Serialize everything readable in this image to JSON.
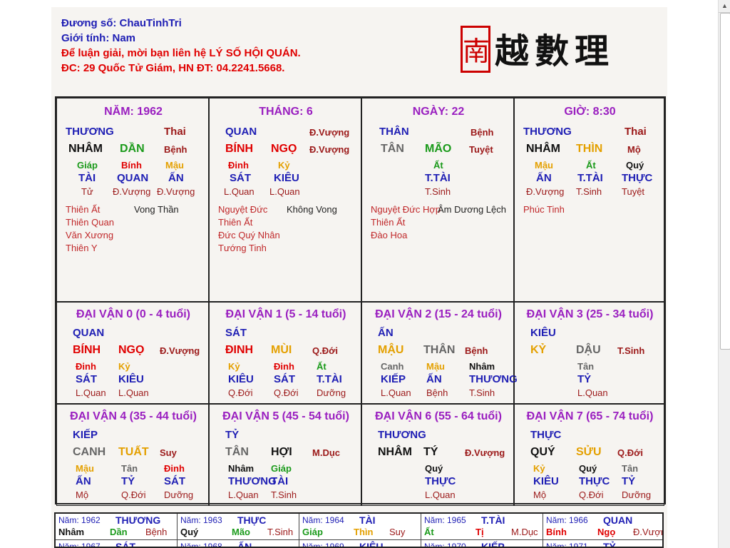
{
  "header": {
    "duong_so": "Đương số: ChauTinhTri",
    "gioi_tinh": "Giới tính:  Nam",
    "contact1": "Để luận giải, mời bạn liên hệ LÝ SỐ HỘI QUÁN.",
    "contact2": "ĐC: 29 Quốc Tử Giám, HN ĐT: 04.2241.5668."
  },
  "logo": {
    "seal": "南",
    "text": "越數理"
  },
  "pillars": [
    {
      "title": "NĂM: 1962",
      "god": "THƯƠNG",
      "phase": "Thai",
      "stem": "NHÂM",
      "branch": "DẦN",
      "branch_phase": "Bệnh",
      "hidden": [
        "Giáp",
        "Bính",
        "Mậu"
      ],
      "hidden_god": [
        "TÀI",
        "QUAN",
        "ẤN"
      ],
      "hidden_phase": [
        "Tử",
        "Đ.Vượng",
        "Đ.Vượng"
      ],
      "stars_l": [
        "Thiên Ất",
        "Thiên Quan",
        "Văn Xương",
        "Thiên Y"
      ],
      "stars_r": [
        "Vong Thần"
      ]
    },
    {
      "title": "THÁNG: 6",
      "god": "QUAN",
      "phase": "Đ.Vượng",
      "stem": "BÍNH",
      "branch": "NGỌ",
      "branch_phase": "Đ.Vượng",
      "hidden": [
        "Đinh",
        "Kỷ"
      ],
      "hidden_god": [
        "SÁT",
        "KIÊU"
      ],
      "hidden_phase": [
        "L.Quan",
        "L.Quan"
      ],
      "stars_l": [
        "Nguyệt Đức",
        "Thiên Ất",
        "Đức Quý Nhân",
        "Tướng Tinh"
      ],
      "stars_r": [
        "Không Vong"
      ]
    },
    {
      "title": "NGÀY: 22",
      "god": "THÂN",
      "phase": "Bệnh",
      "stem": "TÂN",
      "branch": "MÃO",
      "branch_phase": "Tuyệt",
      "hidden": [
        "Ất"
      ],
      "hidden_god": [
        "T.TÀI"
      ],
      "hidden_phase": [
        "T.Sinh"
      ],
      "stars_l": [
        "Nguyệt Đức Hợp",
        "Thiên Ất",
        "Đào Hoa"
      ],
      "stars_r": [
        "Âm Dương Lệch"
      ]
    },
    {
      "title": "GIỜ: 8:30",
      "god": "THƯƠNG",
      "phase": "Thai",
      "stem": "NHÂM",
      "branch": "THÌN",
      "branch_phase": "Mộ",
      "hidden": [
        "Mậu",
        "Ất",
        "Quý"
      ],
      "hidden_god": [
        "ẤN",
        "T.TÀI",
        "THỰC"
      ],
      "hidden_phase": [
        "Đ.Vượng",
        "T.Sinh",
        "Tuyệt"
      ],
      "stars_l": [
        "Phúc Tinh"
      ],
      "stars_r": []
    }
  ],
  "dai_van": [
    {
      "title": "ĐẠI VẬN 0 (0 - 4 tuổi)",
      "god": "QUAN",
      "stem": "BÍNH",
      "branch": "NGỌ",
      "phase": "Đ.Vượng",
      "hidden": [
        "Đinh",
        "Kỷ"
      ],
      "hidden_god": [
        "SÁT",
        "KIÊU"
      ],
      "hidden_phase": [
        "L.Quan",
        "L.Quan"
      ]
    },
    {
      "title": "ĐẠI VẬN 1 (5 - 14 tuổi)",
      "god": "SÁT",
      "stem": "ĐINH",
      "branch": "MÙI",
      "phase": "Q.Đới",
      "hidden": [
        "Kỷ",
        "Đinh",
        "Ất"
      ],
      "hidden_god": [
        "KIÊU",
        "SÁT",
        "T.TÀI"
      ],
      "hidden_phase": [
        "Q.Đới",
        "Q.Đới",
        "Dưỡng"
      ]
    },
    {
      "title": "ĐẠI VẬN 2 (15 - 24 tuổi)",
      "god": "ẤN",
      "stem": "MẬU",
      "branch": "THÂN",
      "phase": "Bệnh",
      "hidden": [
        "Canh",
        "Mậu",
        "Nhâm"
      ],
      "hidden_god": [
        "KIẾP",
        "ẤN",
        "THƯƠNG"
      ],
      "hidden_phase": [
        "L.Quan",
        "Bệnh",
        "T.Sinh"
      ]
    },
    {
      "title": "ĐẠI VẬN 3 (25 - 34 tuổi)",
      "god": "KIÊU",
      "stem": "KỶ",
      "branch": "DẬU",
      "phase": "T.Sinh",
      "hidden": [
        "Tân"
      ],
      "hidden_god": [
        "TỶ"
      ],
      "hidden_phase": [
        "L.Quan"
      ]
    },
    {
      "title": "ĐẠI VẬN 4 (35 - 44 tuổi)",
      "god": "KIẾP",
      "stem": "CANH",
      "branch": "TUẤT",
      "phase": "Suy",
      "hidden": [
        "Mậu",
        "Tân",
        "Đinh"
      ],
      "hidden_god": [
        "ẤN",
        "TỶ",
        "SÁT"
      ],
      "hidden_phase": [
        "Mộ",
        "Q.Đới",
        "Dưỡng"
      ]
    },
    {
      "title": "ĐẠI VẬN 5 (45 - 54 tuổi)",
      "god": "TỶ",
      "stem": "TÂN",
      "branch": "HỢI",
      "phase": "M.Dục",
      "hidden": [
        "Nhâm",
        "Giáp"
      ],
      "hidden_god": [
        "THƯƠNG",
        "TÀI"
      ],
      "hidden_phase": [
        "L.Quan",
        "T.Sinh"
      ]
    },
    {
      "title": "ĐẠI VẬN 6 (55 - 64 tuổi)",
      "god": "THƯƠNG",
      "stem": "NHÂM",
      "branch": "TÝ",
      "phase": "Đ.Vượng",
      "hidden": [
        "Quý"
      ],
      "hidden_god": [
        "THỰC"
      ],
      "hidden_phase": [
        "L.Quan"
      ]
    },
    {
      "title": "ĐẠI VẬN 7 (65 - 74 tuổi)",
      "god": "THỰC",
      "stem": "QUÝ",
      "branch": "SỬU",
      "phase": "Q.Đới",
      "hidden": [
        "Kỷ",
        "Quý",
        "Tân"
      ],
      "hidden_god": [
        "KIÊU",
        "THỰC",
        "TỶ"
      ],
      "hidden_phase": [
        "Mộ",
        "Q.Đới",
        "Dưỡng"
      ]
    }
  ],
  "annual": [
    {
      "year": "Năm: 1962",
      "god": "THƯƠNG",
      "stem": "Nhâm",
      "branch": "Dần",
      "phase": "Bệnh"
    },
    {
      "year": "Năm: 1963",
      "god": "THỰC",
      "stem": "Quý",
      "branch": "Mão",
      "phase": "T.Sinh"
    },
    {
      "year": "Năm: 1964",
      "god": "TÀI",
      "stem": "Giáp",
      "branch": "Thìn",
      "phase": "Suy"
    },
    {
      "year": "Năm: 1965",
      "god": "T.TÀI",
      "stem": "Ất",
      "branch": "Tị",
      "phase": "M.Dục"
    },
    {
      "year": "Năm: 1966",
      "god": "QUAN",
      "stem": "Bính",
      "branch": "Ngọ",
      "phase": "Đ.Vượng"
    }
  ],
  "annual_next": [
    {
      "year": "Năm: 1967",
      "god": "SÁT"
    },
    {
      "year": "Năm: 1968",
      "god": "ẤN"
    },
    {
      "year": "Năm: 1969",
      "god": "KIÊU"
    },
    {
      "year": "Năm: 1970",
      "god": "KIẾP"
    },
    {
      "year": "Năm: 1971",
      "god": "TỶ"
    }
  ],
  "colors": {
    "blue": "#1e1eb4",
    "red": "#e00000",
    "purple": "#9a1fc0",
    "green": "#1a9a1a",
    "orange": "#e4a000",
    "darkred": "#9b1818"
  }
}
